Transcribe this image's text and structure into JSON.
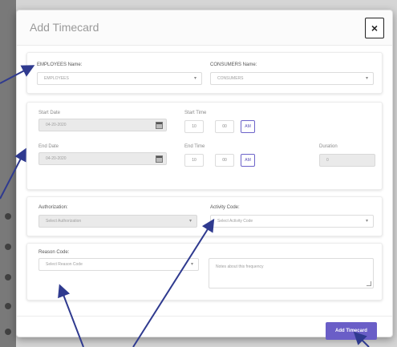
{
  "modal": {
    "title": "Add Timecard",
    "close_label": "×"
  },
  "employee": {
    "label": "EMPLOYEES Name:",
    "value": "EMPLOYEES"
  },
  "consumer": {
    "label": "CONSUMERS Name:",
    "value": "CONSUMERS"
  },
  "start": {
    "date_label": "Start Date",
    "date_value": "04-20-2020",
    "time_label": "Start Time",
    "hour": "10",
    "minute": "00",
    "ampm": "AM"
  },
  "end": {
    "date_label": "End Date",
    "date_value": "04-20-2020",
    "time_label": "End Time",
    "hour": "10",
    "minute": "00",
    "ampm": "AM"
  },
  "duration": {
    "label": "Duration",
    "value": "0"
  },
  "authorization": {
    "label": "Authorization:",
    "placeholder": "Select Authorization"
  },
  "activity": {
    "label": "Activity Code:",
    "placeholder": "Select Activity Code"
  },
  "reason": {
    "label": "Reason Code:",
    "placeholder": "Select Reason Code"
  },
  "notes": {
    "placeholder": "Notes about this frequency"
  },
  "submit_label": "Add Timecard",
  "icons": {
    "caret": "▾",
    "calendar": "calendar-icon"
  },
  "colors": {
    "accent": "#6a5ec7",
    "arrow": "#2f3a8f"
  }
}
